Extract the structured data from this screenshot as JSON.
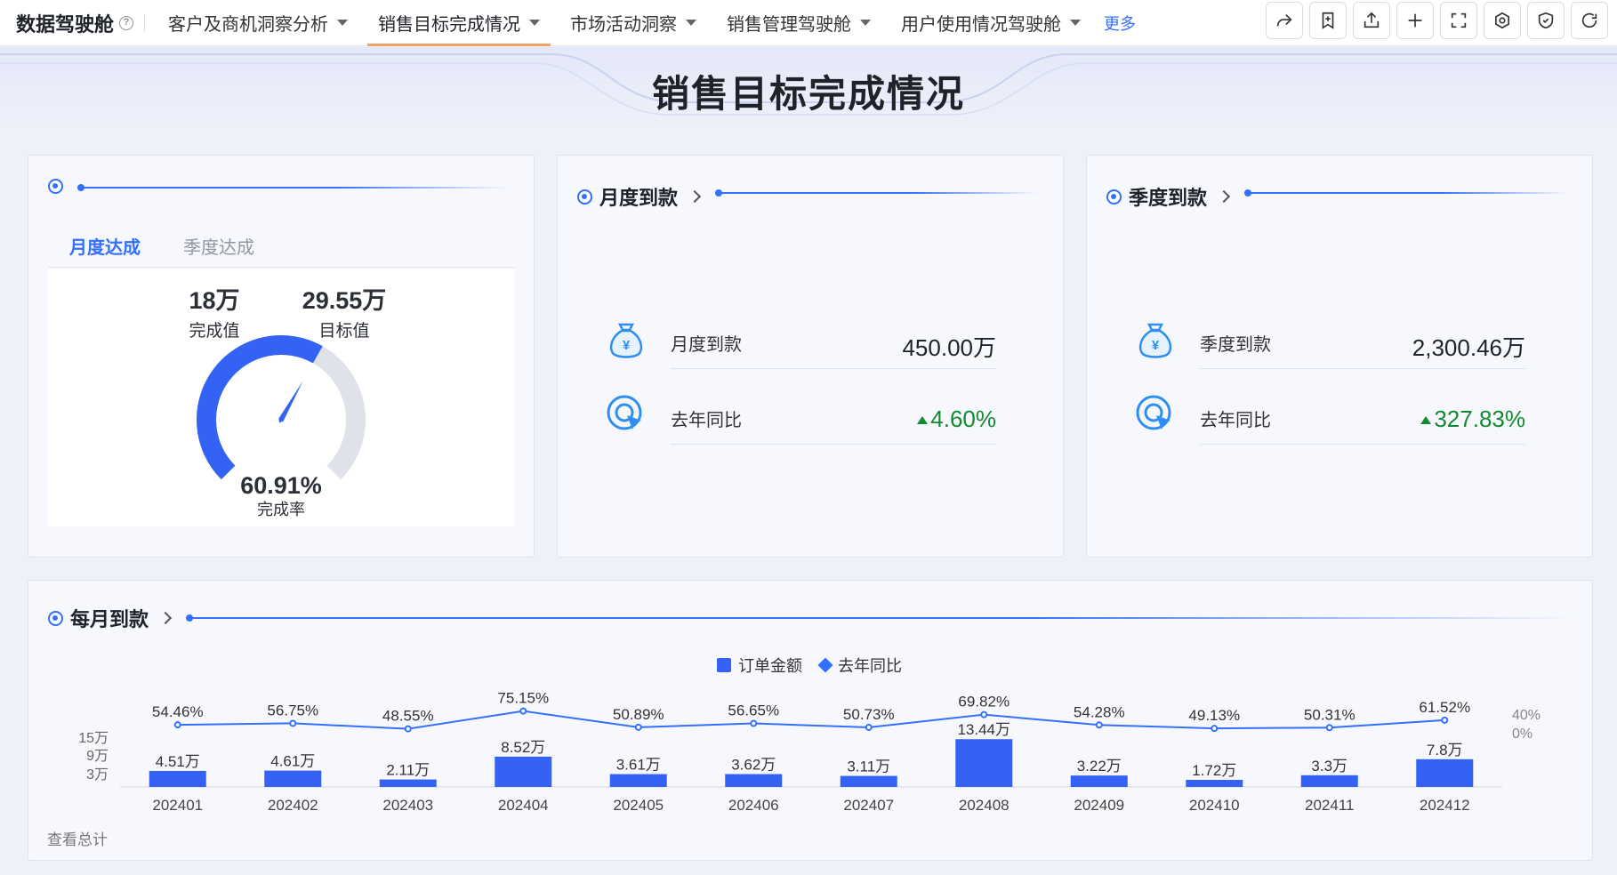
{
  "nav": {
    "brand": "数据驾驶舱",
    "tabs": [
      {
        "label": "客户及商机洞察分析"
      },
      {
        "label": "销售目标完成情况"
      },
      {
        "label": "市场活动洞察"
      },
      {
        "label": "销售管理驾驶舱"
      },
      {
        "label": "用户使用情况驾驶舱"
      }
    ],
    "more": "更多",
    "tool_icons": [
      "share-icon",
      "bookmark-icon",
      "export-icon",
      "add-icon",
      "fullscreen-icon",
      "settings-icon",
      "shield-icon",
      "refresh-icon"
    ]
  },
  "page_title": "销售目标完成情况",
  "achievement_card": {
    "tabs": [
      "月度达成",
      "季度达成"
    ],
    "completed_value": "18万",
    "completed_label": "完成值",
    "target_value": "29.55万",
    "target_label": "目标值",
    "rate_text": "60.91%",
    "rate_label": "完成率",
    "rate": 0.6091,
    "colors": {
      "fill": "#3362f5",
      "track": "#dfe2e8"
    }
  },
  "monthly_card": {
    "title": "月度到款",
    "amount_label": "月度到款",
    "amount_value": "450.00万",
    "yoy_label": "去年同比",
    "yoy_value": "4.60%"
  },
  "quarterly_card": {
    "title": "季度到款",
    "amount_label": "季度到款",
    "amount_value": "2,300.46万",
    "yoy_label": "去年同比",
    "yoy_value": "327.83%"
  },
  "bottom_card": {
    "title": "每月到款",
    "footnote": "查看总计"
  },
  "chart_data": {
    "type": "bar",
    "categories": [
      "202401",
      "202402",
      "202403",
      "202404",
      "202405",
      "202406",
      "202407",
      "202408",
      "202409",
      "202410",
      "202411",
      "202412"
    ],
    "series": [
      {
        "name": "订单金额",
        "type": "bar",
        "values": [
          4.51,
          4.61,
          2.11,
          8.52,
          3.61,
          3.62,
          3.11,
          13.44,
          3.22,
          1.72,
          3.3,
          7.8
        ],
        "labels": [
          "4.51万",
          "4.61万",
          "2.11万",
          "8.52万",
          "3.61万",
          "3.62万",
          "3.11万",
          "13.44万",
          "3.22万",
          "1.72万",
          "3.3万",
          "7.8万"
        ]
      },
      {
        "name": "去年同比",
        "type": "line",
        "values": [
          54.46,
          56.75,
          48.55,
          75.15,
          50.89,
          56.65,
          50.73,
          69.82,
          54.28,
          49.13,
          50.31,
          61.52
        ],
        "labels": [
          "54.46%",
          "56.75%",
          "48.55%",
          "75.15%",
          "50.89%",
          "56.65%",
          "50.73%",
          "69.82%",
          "54.28%",
          "49.13%",
          "50.31%",
          "61.52%"
        ]
      }
    ],
    "left_ticks": [
      "15万",
      "9万",
      "3万"
    ],
    "right_ticks": [
      "40%",
      "0%"
    ],
    "legend_position": "top-center",
    "colors": {
      "bar": "#3362f5",
      "line": "#3370ff"
    }
  }
}
